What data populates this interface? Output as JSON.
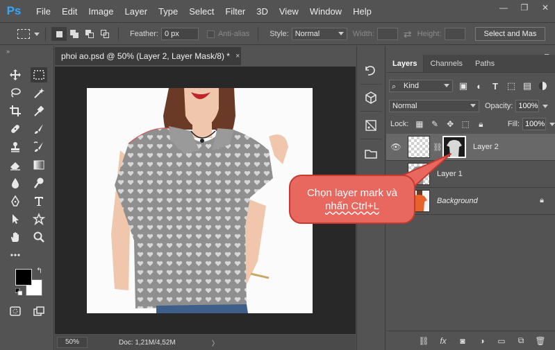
{
  "app": {
    "logo": "Ps"
  },
  "menu": [
    "File",
    "Edit",
    "Image",
    "Layer",
    "Type",
    "Select",
    "Filter",
    "3D",
    "View",
    "Window",
    "Help"
  ],
  "window_controls": {
    "minimize": "—",
    "restore": "❐",
    "close": "✕"
  },
  "options_bar": {
    "feather_label": "Feather:",
    "feather_value": "0 px",
    "antialias_label": "Anti-alias",
    "style_label": "Style:",
    "style_value": "Normal",
    "width_label": "Width:",
    "height_label": "Height:",
    "select_mask_label": "Select and Mas"
  },
  "document": {
    "tab_title": "phoi ao.psd @ 50% (Layer 2, Layer Mask/8) *",
    "tab_close": "×",
    "zoom": "50%",
    "doc_size": "Doc: 1,21M/4,52M",
    "status_arrow": "〉"
  },
  "layers_panel": {
    "tabs": [
      "Layers",
      "Channels",
      "Paths"
    ],
    "active_tab": "Layers",
    "filter_kind": "Kind",
    "blend_mode": "Normal",
    "opacity_label": "Opacity:",
    "opacity_value": "100%",
    "lock_label": "Lock:",
    "fill_label": "Fill:",
    "fill_value": "100%",
    "layers": [
      {
        "name": "Layer 2",
        "visible": true,
        "selected": true,
        "has_mask": true
      },
      {
        "name": "Layer 1",
        "visible": false,
        "selected": false,
        "has_mask": false
      },
      {
        "name": "Background",
        "visible": false,
        "selected": false,
        "has_mask": false,
        "locked": true
      }
    ]
  },
  "callout": {
    "line1": "Chọn layer mark và",
    "line2": "nhấn Ctrl+L"
  },
  "colors": {
    "ui_bg": "#535353",
    "canvas_bg": "#282828",
    "accent_blue": "#31a8ff",
    "callout_fill": "#e8685f",
    "callout_border": "#c43a2e",
    "foreground": "#000000",
    "background": "#ffffff"
  }
}
